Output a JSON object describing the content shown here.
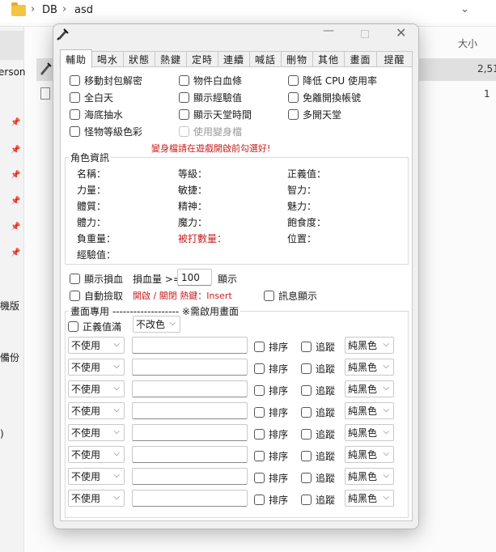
{
  "explorer": {
    "breadcrumb": [
      "DB",
      "asd"
    ],
    "window_controls": [
      "—"
    ],
    "column_header": "大小",
    "left_labels": [
      "erson",
      "機版",
      "備份",
      ")"
    ],
    "row_values": [
      "2,51",
      "1"
    ]
  },
  "dialog": {
    "title": "",
    "tabs": [
      "輔助",
      "喝水",
      "狀態",
      "熱鍵",
      "定時",
      "連續",
      "喊話",
      "刪物",
      "其他",
      "畫面",
      "提醒"
    ],
    "options": [
      {
        "label": "移動封包解密",
        "checked": false,
        "disabled": false
      },
      {
        "label": "物件白血條",
        "checked": false,
        "disabled": false
      },
      {
        "label": "降低 CPU 使用率",
        "checked": false,
        "disabled": false
      },
      {
        "label": "全白天",
        "checked": false,
        "disabled": false
      },
      {
        "label": "顯示經驗值",
        "checked": false,
        "disabled": false
      },
      {
        "label": "免離開換帳號",
        "checked": false,
        "disabled": false
      },
      {
        "label": "海底抽水",
        "checked": false,
        "disabled": false
      },
      {
        "label": "顯示天堂時間",
        "checked": false,
        "disabled": false
      },
      {
        "label": "多開天堂",
        "checked": false,
        "disabled": false
      },
      {
        "label": "怪物等級色彩",
        "checked": false,
        "disabled": false
      },
      {
        "label": "使用變身檔",
        "checked": false,
        "disabled": true
      }
    ],
    "warning": "變身檔請在遊戲開啟前勾選好!",
    "char_info": {
      "title": "角色資訊",
      "fields": [
        "名稱：",
        "等級：",
        "正義值：",
        "力量：",
        "敏捷：",
        "智力：",
        "體質：",
        "精神：",
        "魅力：",
        "體力：",
        "魔力：",
        "飽食度：",
        "負重量：",
        "被打數量：",
        "位置：",
        "經驗值："
      ]
    },
    "show_damage": {
      "label": "顯示損血",
      "threshold_label": "損血量 >=",
      "threshold_value": "100",
      "suffix": "顯示"
    },
    "auto_pickup": {
      "label": "自動撿取",
      "hotkey_text": "開啟 / 關閉 熱鍵：Insert"
    },
    "msg_display": {
      "label": "訊息顯示"
    },
    "screen": {
      "title": "畫面專用 ------------------- ※需啟用畫面",
      "justice_full": {
        "label": "正義值滿",
        "option": "不改色"
      },
      "rows": [
        {
          "mode": "不使用",
          "text": "",
          "sort": "排序",
          "track": "追蹤",
          "color": "純黑色"
        },
        {
          "mode": "不使用",
          "text": "",
          "sort": "排序",
          "track": "追蹤",
          "color": "純黑色"
        },
        {
          "mode": "不使用",
          "text": "",
          "sort": "排序",
          "track": "追蹤",
          "color": "純黑色"
        },
        {
          "mode": "不使用",
          "text": "",
          "sort": "排序",
          "track": "追蹤",
          "color": "純黑色"
        },
        {
          "mode": "不使用",
          "text": "",
          "sort": "排序",
          "track": "追蹤",
          "color": "純黑色"
        },
        {
          "mode": "不使用",
          "text": "",
          "sort": "排序",
          "track": "追蹤",
          "color": "純黑色"
        },
        {
          "mode": "不使用",
          "text": "",
          "sort": "排序",
          "track": "追蹤",
          "color": "純黑色"
        },
        {
          "mode": "不使用",
          "text": "",
          "sort": "排序",
          "track": "追蹤",
          "color": "純黑色"
        }
      ]
    }
  },
  "colors": {
    "warning": "#c81e1e",
    "panel": "#ffffff",
    "dialog_bg": "#f0f0f0"
  }
}
